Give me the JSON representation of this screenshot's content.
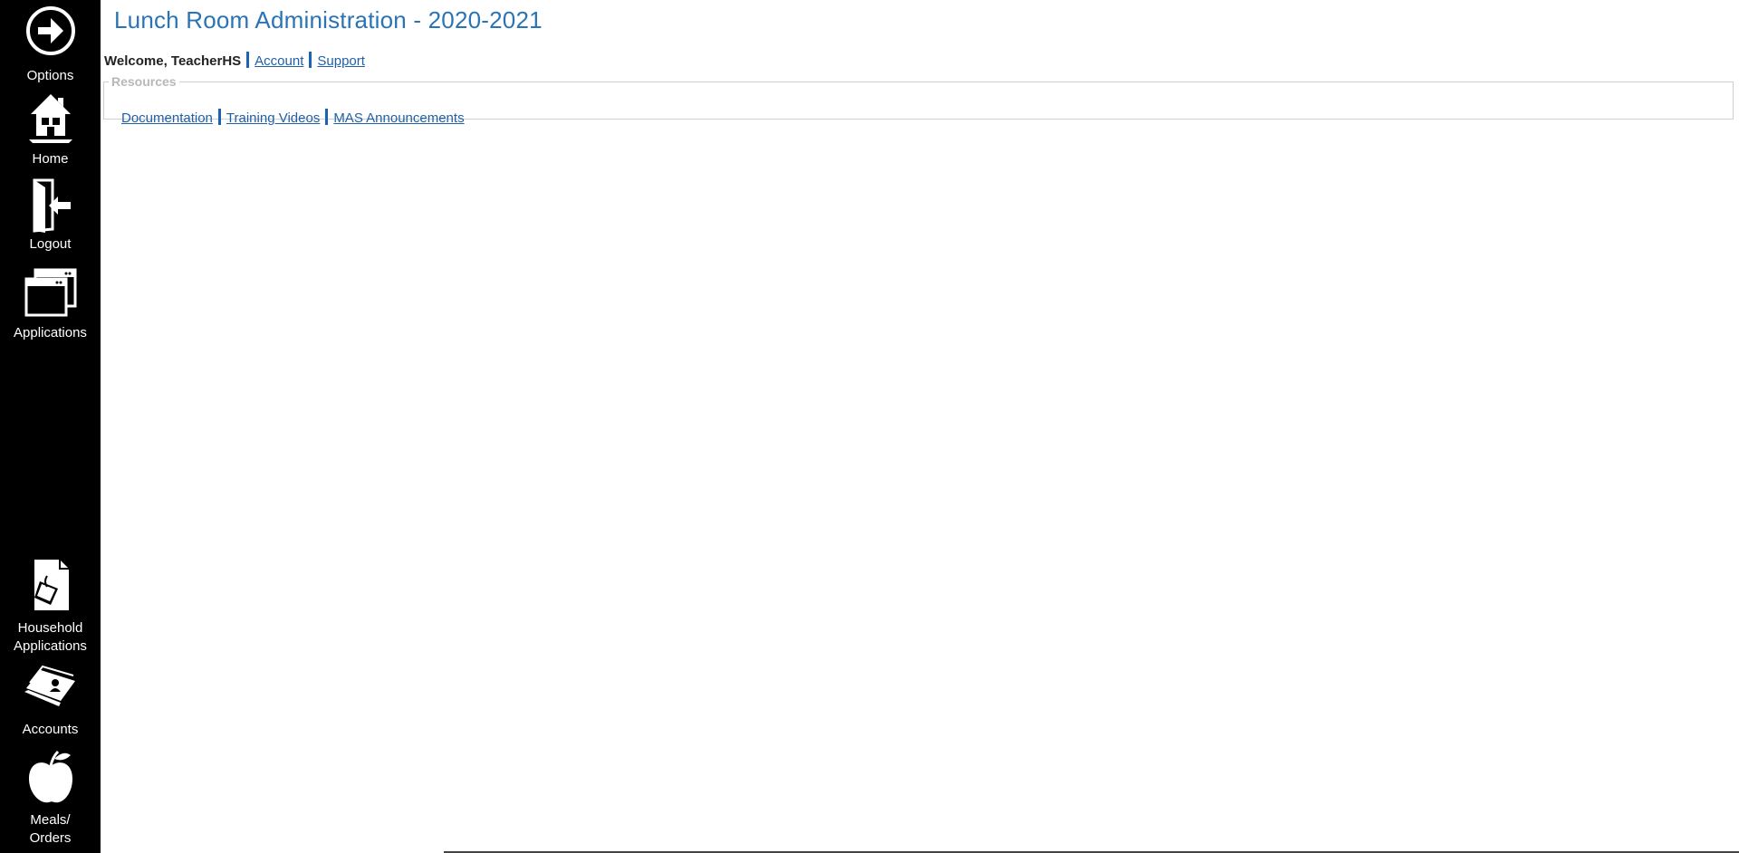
{
  "sidebar": {
    "items": [
      {
        "label": "Options",
        "icon": "arrow-right-circle-icon"
      },
      {
        "label": "Home",
        "icon": "house-icon"
      },
      {
        "label": "Logout",
        "icon": "door-exit-icon"
      },
      {
        "label": "Applications",
        "icon": "windows-icon"
      },
      {
        "label_line1": "Household",
        "label_line2": "Applications",
        "icon": "document-clip-icon"
      },
      {
        "label": "Accounts",
        "icon": "id-cards-icon"
      },
      {
        "label_line1": "Meals/",
        "label_line2": "Orders",
        "icon": "apple-icon"
      }
    ]
  },
  "header": {
    "title": "Lunch Room Administration - 2020-2021",
    "welcome": "Welcome, TeacherHS",
    "account_link": "Account",
    "support_link": "Support"
  },
  "resources": {
    "legend": "Resources",
    "links": [
      "Documentation",
      "Training Videos",
      "MAS Announcements"
    ]
  },
  "colors": {
    "sidebar_bg": "#000000",
    "title": "#2a74b5",
    "link": "#1f5fa8",
    "separator": "#1a63b0"
  }
}
